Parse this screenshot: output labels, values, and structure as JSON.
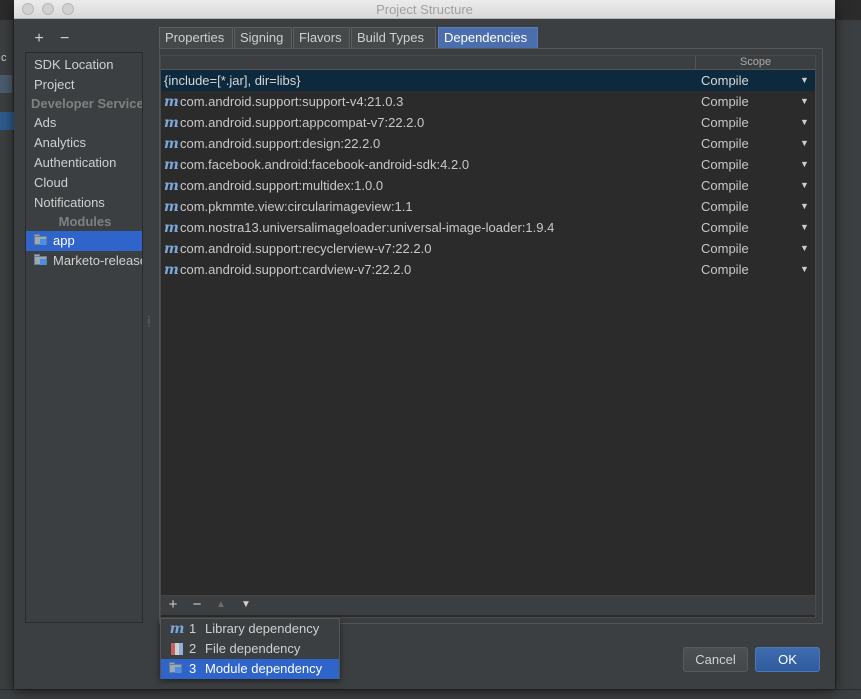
{
  "window": {
    "title": "Project Structure"
  },
  "left_panel": {
    "add_label": "+",
    "remove_label": "−",
    "items": [
      {
        "label": "SDK Location"
      },
      {
        "label": "Project"
      }
    ],
    "developer_services_header": "Developer Services",
    "services": [
      {
        "label": "Ads"
      },
      {
        "label": "Analytics"
      },
      {
        "label": "Authentication"
      },
      {
        "label": "Cloud"
      },
      {
        "label": "Notifications"
      }
    ],
    "modules_header": "Modules",
    "modules": [
      {
        "label": "app",
        "selected": true
      },
      {
        "label": "Marketo-release",
        "selected": false
      }
    ]
  },
  "tabs": [
    {
      "label": "Properties"
    },
    {
      "label": "Signing"
    },
    {
      "label": "Flavors"
    },
    {
      "label": "Build Types"
    },
    {
      "label": "Dependencies",
      "active": true
    }
  ],
  "table": {
    "columns": [
      "",
      "Scope"
    ],
    "rows": [
      {
        "icon": "",
        "name": "{include=[*.jar], dir=libs}",
        "scope": "Compile",
        "selected": true
      },
      {
        "icon": "m",
        "name": "com.android.support:support-v4:21.0.3",
        "scope": "Compile"
      },
      {
        "icon": "m",
        "name": "com.android.support:appcompat-v7:22.2.0",
        "scope": "Compile"
      },
      {
        "icon": "m",
        "name": "com.android.support:design:22.2.0",
        "scope": "Compile"
      },
      {
        "icon": "m",
        "name": "com.facebook.android:facebook-android-sdk:4.2.0",
        "scope": "Compile"
      },
      {
        "icon": "m",
        "name": "com.android.support:multidex:1.0.0",
        "scope": "Compile"
      },
      {
        "icon": "m",
        "name": "com.pkmmte.view:circularimageview:1.1",
        "scope": "Compile"
      },
      {
        "icon": "m",
        "name": "com.nostra13.universalimageloader:universal-image-loader:1.9.4",
        "scope": "Compile"
      },
      {
        "icon": "m",
        "name": "com.android.support:recyclerview-v7:22.2.0",
        "scope": "Compile"
      },
      {
        "icon": "m",
        "name": "com.android.support:cardview-v7:22.2.0",
        "scope": "Compile"
      }
    ],
    "toolbar": {
      "add": "+",
      "remove": "−",
      "up": "▲",
      "down": "▼"
    }
  },
  "popup": {
    "items": [
      {
        "num": "1",
        "label": "Library dependency",
        "icon": "m"
      },
      {
        "num": "2",
        "label": "File dependency",
        "icon": "file"
      },
      {
        "num": "3",
        "label": "Module dependency",
        "icon": "module",
        "selected": true
      }
    ]
  },
  "buttons": {
    "cancel": "Cancel",
    "ok": "OK"
  },
  "colors": {
    "accent": "#2f65ca",
    "selected_row": "#0d293e",
    "background": "#3c3f41"
  }
}
